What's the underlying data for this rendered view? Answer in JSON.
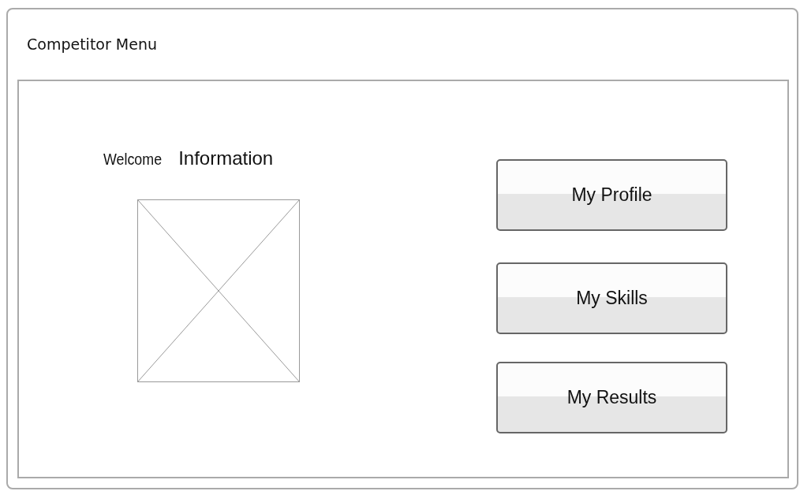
{
  "window": {
    "title": "Competitor Menu"
  },
  "welcome": {
    "label": "Welcome",
    "heading": "Information"
  },
  "image": {
    "kind": "placeholder"
  },
  "buttons": [
    "My Profile",
    "My Skills",
    "My Results"
  ]
}
